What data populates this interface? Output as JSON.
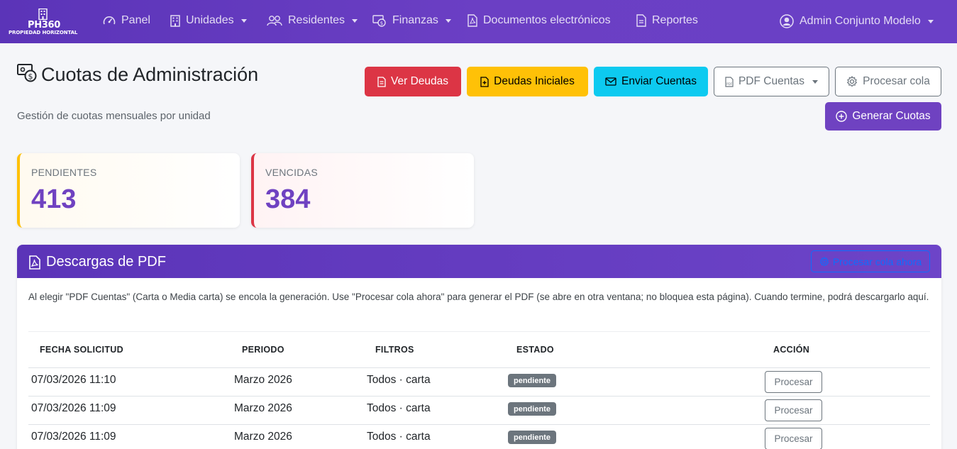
{
  "brand": {
    "name": "PH360",
    "subtitle": "PROPIEDAD HORIZONTAL"
  },
  "nav": {
    "items": [
      {
        "label": "Panel",
        "icon": "gauge-icon"
      },
      {
        "label": "Unidades",
        "icon": "building-icon",
        "dropdown": true
      },
      {
        "label": "Residentes",
        "icon": "people-icon",
        "dropdown": true
      },
      {
        "label": "Finanzas",
        "icon": "cash-icon",
        "dropdown": true
      },
      {
        "label": "Documentos electrónicos",
        "icon": "pdf-file-icon"
      },
      {
        "label": "Reportes",
        "icon": "report-icon"
      }
    ],
    "user": {
      "label": "Admin Conjunto Modelo",
      "icon": "user-circle-icon"
    }
  },
  "header": {
    "title": "Cuotas de Administración",
    "subtitle": "Gestión de cuotas mensuales por unidad"
  },
  "actions": {
    "ver_deudas": "Ver Deudas",
    "deudas_iniciales": "Deudas Iniciales",
    "enviar_cuentas": "Enviar Cuentas",
    "pdf_cuentas": "PDF Cuentas",
    "procesar_cola": "Procesar cola",
    "generar_cuotas": "Generar Cuotas"
  },
  "stats": {
    "pendientes": {
      "label": "PENDIENTES",
      "value": "413"
    },
    "vencidas": {
      "label": "VENCIDAS",
      "value": "384"
    }
  },
  "pdf_downloads": {
    "title": "Descargas de PDF",
    "process_now": "Procesar cola ahora",
    "description": "Al elegir \"PDF Cuentas\" (Carta o Media carta) se encola la generación. Use \"Procesar cola ahora\" para generar el PDF (se abre en otra ventana; no bloquea esta página). Cuando termine, podrá descargarlo aquí.",
    "columns": [
      "FECHA SOLICITUD",
      "PERIODO",
      "FILTROS",
      "ESTADO",
      "ACCIÓN"
    ],
    "rows": [
      {
        "fecha": "07/03/2026 11:10",
        "periodo": "Marzo 2026",
        "filtros": "Todos · carta",
        "estado": "pendiente",
        "accion": "Procesar"
      },
      {
        "fecha": "07/03/2026 11:09",
        "periodo": "Marzo 2026",
        "filtros": "Todos · carta",
        "estado": "pendiente",
        "accion": "Procesar"
      },
      {
        "fecha": "07/03/2026 11:09",
        "periodo": "Marzo 2026",
        "filtros": "Todos · carta",
        "estado": "pendiente",
        "accion": "Procesar"
      }
    ]
  },
  "colors": {
    "primary": "#6f42c1",
    "navbar": "#6237be",
    "danger": "#dc3545",
    "warning": "#ffc107",
    "info": "#0dcaf0",
    "secondary": "#6c757d"
  }
}
